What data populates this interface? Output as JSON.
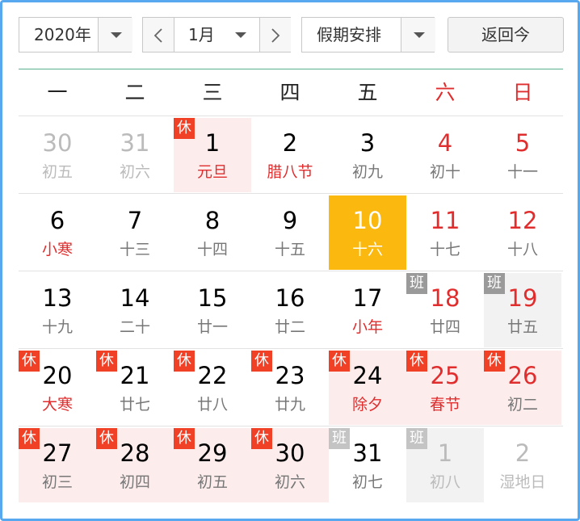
{
  "toolbar": {
    "year": "2020年",
    "prev_icon": "chevron-left-icon",
    "month": "1月",
    "next_icon": "chevron-right-icon",
    "holiday": "假期安排",
    "today_btn": "返回今"
  },
  "weekdays": [
    "一",
    "二",
    "三",
    "四",
    "五",
    "六",
    "日"
  ],
  "colors": {
    "accent": "#58a8f0",
    "holiday_bg": "#fdecec",
    "today_bg": "#fbb80f",
    "rest_badge": "#f04026",
    "work_badge": "#9a9a9a",
    "red": "#e02d2d"
  },
  "badges": {
    "rest": "休",
    "work": "班"
  },
  "weeks": [
    [
      {
        "day": "30",
        "lunar": "初五",
        "other": true
      },
      {
        "day": "31",
        "lunar": "初六",
        "other": true
      },
      {
        "day": "1",
        "lunar": "元旦",
        "fest": true,
        "hol": true,
        "badge": "rest"
      },
      {
        "day": "2",
        "lunar": "腊八节",
        "fest": true
      },
      {
        "day": "3",
        "lunar": "初九"
      },
      {
        "day": "4",
        "lunar": "初十",
        "we": true
      },
      {
        "day": "5",
        "lunar": "十一",
        "we": true
      }
    ],
    [
      {
        "day": "6",
        "lunar": "小寒",
        "fest": true
      },
      {
        "day": "7",
        "lunar": "十三"
      },
      {
        "day": "8",
        "lunar": "十四"
      },
      {
        "day": "9",
        "lunar": "十五"
      },
      {
        "day": "10",
        "lunar": "十六",
        "today": true
      },
      {
        "day": "11",
        "lunar": "十七",
        "we": true
      },
      {
        "day": "12",
        "lunar": "十八",
        "we": true
      }
    ],
    [
      {
        "day": "13",
        "lunar": "十九"
      },
      {
        "day": "14",
        "lunar": "二十"
      },
      {
        "day": "15",
        "lunar": "廿一"
      },
      {
        "day": "16",
        "lunar": "廿二"
      },
      {
        "day": "17",
        "lunar": "小年",
        "fest": true
      },
      {
        "day": "18",
        "lunar": "廿四",
        "we": true,
        "badge": "work"
      },
      {
        "day": "19",
        "lunar": "廿五",
        "we": true,
        "gray": true,
        "badge": "work"
      }
    ],
    [
      {
        "day": "20",
        "lunar": "大寒",
        "fest": true,
        "badge": "rest"
      },
      {
        "day": "21",
        "lunar": "廿七",
        "badge": "rest"
      },
      {
        "day": "22",
        "lunar": "廿八",
        "badge": "rest"
      },
      {
        "day": "23",
        "lunar": "廿九",
        "badge": "rest"
      },
      {
        "day": "24",
        "lunar": "除夕",
        "fest": true,
        "hol": true,
        "badge": "rest"
      },
      {
        "day": "25",
        "lunar": "春节",
        "fest": true,
        "we": true,
        "hol": true,
        "badge": "rest"
      },
      {
        "day": "26",
        "lunar": "初二",
        "we": true,
        "hol": true,
        "badge": "rest"
      }
    ],
    [
      {
        "day": "27",
        "lunar": "初三",
        "hol": true,
        "badge": "rest"
      },
      {
        "day": "28",
        "lunar": "初四",
        "hol": true,
        "badge": "rest"
      },
      {
        "day": "29",
        "lunar": "初五",
        "hol": true,
        "badge": "rest"
      },
      {
        "day": "30",
        "lunar": "初六",
        "hol": true,
        "badge": "rest"
      },
      {
        "day": "31",
        "lunar": "初七",
        "badge": "work-light"
      },
      {
        "day": "1",
        "lunar": "初八",
        "other": true,
        "gray": true,
        "badge": "work-light"
      },
      {
        "day": "2",
        "lunar": "湿地日",
        "other": true
      }
    ]
  ]
}
